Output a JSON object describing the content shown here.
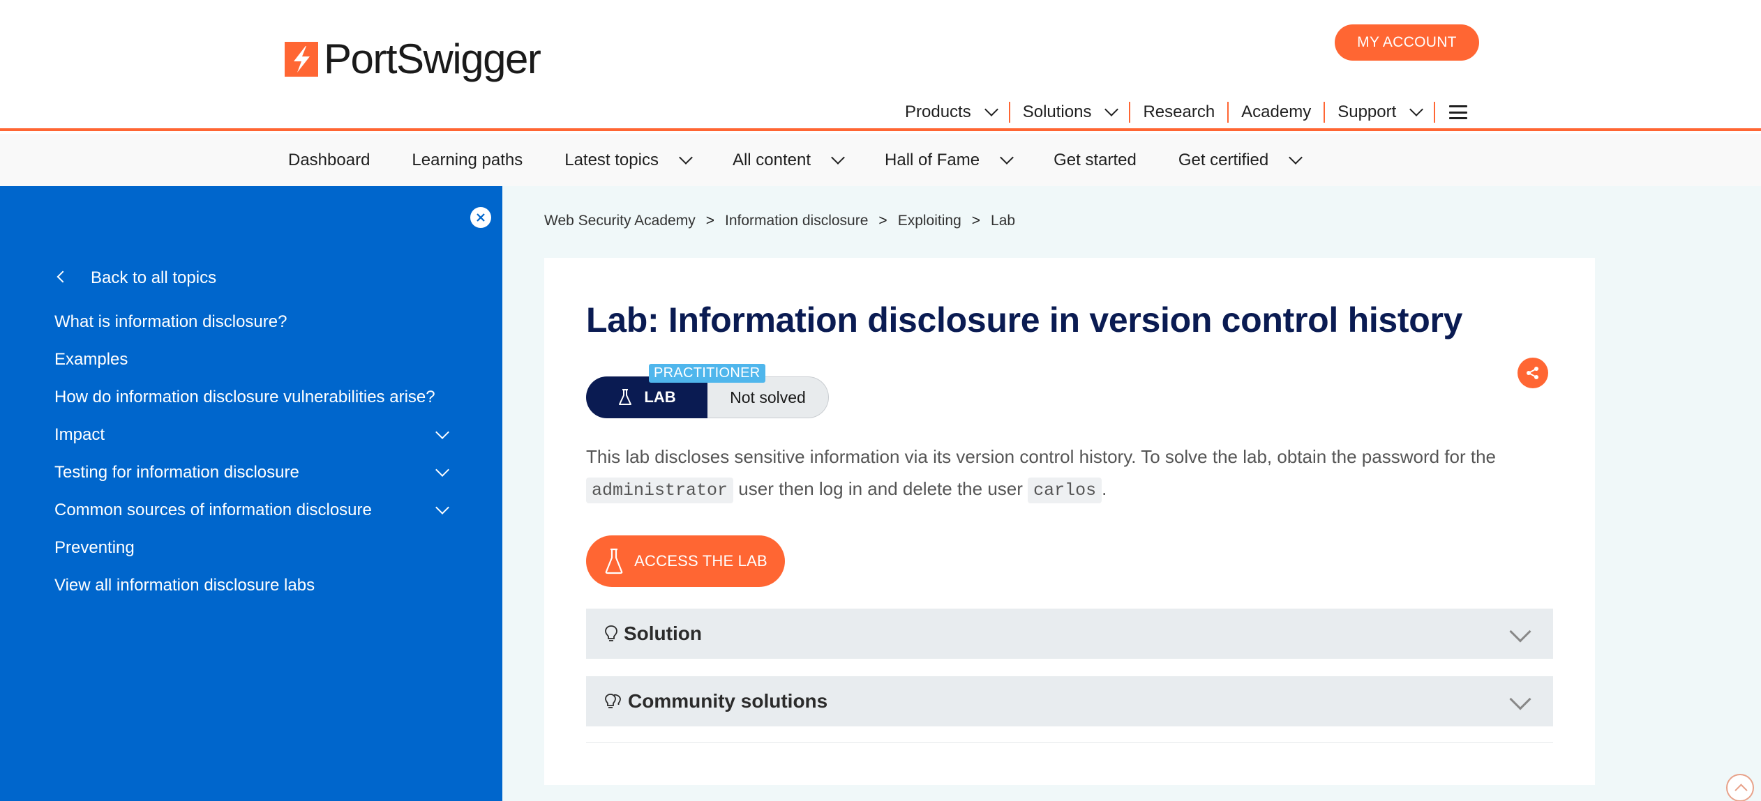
{
  "brand": {
    "name": "PortSwigger",
    "accent": "#ff6633",
    "navy": "#0a1b52",
    "sidebar_blue": "#0066cc"
  },
  "header": {
    "my_account": "MY ACCOUNT",
    "nav": [
      "Products",
      "Solutions",
      "Research",
      "Academy",
      "Support"
    ]
  },
  "subnav": {
    "items": [
      "Dashboard",
      "Learning paths",
      "Latest topics",
      "All content",
      "Hall of Fame",
      "Get started",
      "Get certified"
    ]
  },
  "sidebar": {
    "back": "Back to all topics",
    "items": [
      {
        "label": "What is information disclosure?"
      },
      {
        "label": "Examples"
      },
      {
        "label": "How do information disclosure vulnerabilities arise?"
      },
      {
        "label": "Impact"
      },
      {
        "label": "Testing for information disclosure"
      },
      {
        "label": "Common sources of information disclosure"
      },
      {
        "label": "Preventing"
      },
      {
        "label": "View all information disclosure labs"
      }
    ]
  },
  "breadcrumb": [
    "Web Security Academy",
    "Information disclosure",
    "Exploiting",
    "Lab"
  ],
  "lab": {
    "title": "Lab: Information disclosure in version control history",
    "level": "PRACTITIONER",
    "type": "LAB",
    "status": "Not solved",
    "desc_part1": "This lab discloses sensitive information via its version control history. To solve the lab, obtain the password for the ",
    "code1": "administrator",
    "desc_part2": " user then log in and delete the user ",
    "code2": "carlos",
    "desc_part3": ".",
    "access_button": "ACCESS THE LAB",
    "accordions": [
      "Solution",
      "Community solutions"
    ]
  }
}
